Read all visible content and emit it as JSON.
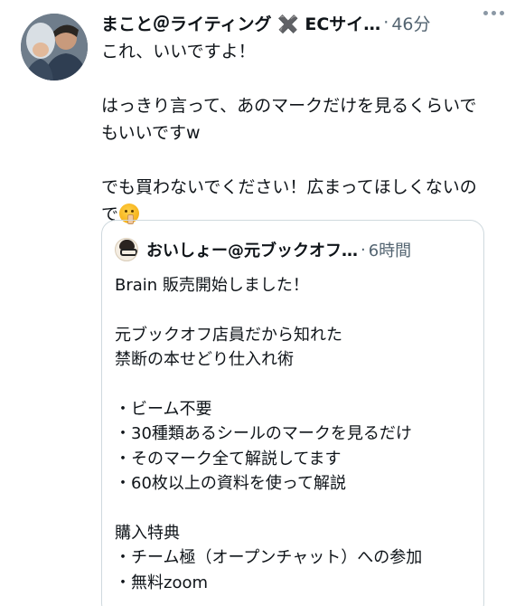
{
  "tweet": {
    "author": "まこと＠ライティング ✖️ ECサイ…",
    "separator": "·",
    "time": "46分",
    "text": "これ、いいですよ！\n\nはっきり言って、あのマークだけを見るくらいでもいいですw\n\nでも買わないでください！広まってほしくないので",
    "emoji": "shushing-face"
  },
  "quote": {
    "author": "おいしょー@元ブックオフ…",
    "separator": "·",
    "time": "6時間",
    "text": "Brain 販売開始しました！\n\n元ブックオフ店員だから知れた\n禁断の本せどり仕入れ術\n\n・ビーム不要\n・30種類あるシールのマークを見るだけ\n・そのマーク全て解説してます\n・60枚以上の資料を使って解説\n\n購入特典\n・チーム極（オープンチャット）への参加\n・無料zoom"
  }
}
